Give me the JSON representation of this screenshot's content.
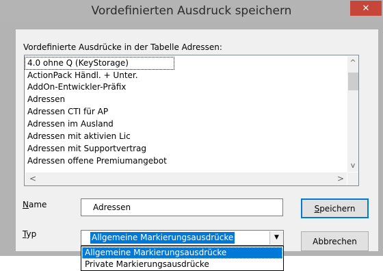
{
  "window": {
    "title": "Vordefinierten Ausdruck speichern",
    "close_glyph": "✕"
  },
  "list": {
    "caption": "Vordefinierte Ausdrücke in der Tabelle Adressen:",
    "items": [
      "4.0 ohne Q (KeyStorage)",
      "ActionPack Händl. + Unter.",
      "AddOn-Entwickler-Präfix",
      "Adressen",
      "Adressen CTI für AP",
      "Adressen im Ausland",
      "Adressen mit aktivien Lic",
      "Adressen mit Supportvertrag",
      "Adressen offene Premiumangebot"
    ],
    "scroll_up": "^",
    "scroll_down": "v",
    "scroll_left": "<",
    "scroll_right": ">"
  },
  "name_field": {
    "label_mnemonic": "N",
    "label_rest": "ame",
    "value": "Adressen"
  },
  "type_field": {
    "label_mnemonic": "T",
    "label_rest": "yp",
    "selected": "Allgemeine Markierungsausdrücke",
    "arrow": "▼",
    "options": [
      "Allgemeine Markierungsausdrücke",
      "Private Markierungsausdrücke"
    ]
  },
  "buttons": {
    "save_mnemonic": "S",
    "save_rest": "peichern",
    "cancel": "Abbrechen"
  },
  "colors": {
    "accent": "#0078d7",
    "close": "#c7463a",
    "frame": "#b3b3b3",
    "client": "#f0f0f0"
  }
}
